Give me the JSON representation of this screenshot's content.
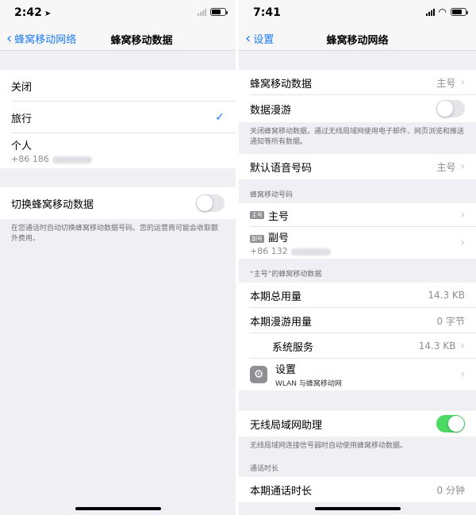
{
  "left": {
    "status": {
      "time": "2:42",
      "location_glyph": "➤"
    },
    "nav": {
      "back_label": "蜂窝移动网络",
      "title": "蜂窝移动数据"
    },
    "lines": [
      {
        "label": "关闭"
      },
      {
        "label": "旅行",
        "checked": true
      },
      {
        "label": "个人",
        "number": "+86 186"
      }
    ],
    "switch_row": {
      "label": "切换蜂窝移动数据",
      "on": false
    },
    "footer": "在您通话时自动切换蜂窝移动数据号码。您的运营商可能会收取额外费用。"
  },
  "right": {
    "status": {
      "time": "7:41"
    },
    "nav": {
      "back_label": "设置",
      "title": "蜂窝移动网络"
    },
    "group1": {
      "cellular_data_label": "蜂窝移动数据",
      "cellular_data_value": "主号",
      "roaming_label": "数据漫游",
      "roaming_on": false
    },
    "footer1": "关闭蜂窝移动数据，通过无线局域网使用电子邮件、网页浏览和推送通知等所有数据。",
    "default_voice": {
      "label": "默认语音号码",
      "value": "主号"
    },
    "numbers_header": "蜂窝移动号码",
    "numbers": [
      {
        "badge": "主号",
        "label": "主号"
      },
      {
        "badge": "副号",
        "label": "副号",
        "number": "+86 132"
      }
    ],
    "usage_header": "“主号”的蜂窝移动数据",
    "usage": [
      {
        "label": "本期总用量",
        "value": "14.3 KB"
      },
      {
        "label": "本期漫游用量",
        "value": "0 字节"
      },
      {
        "label": "系统服务",
        "value": "14.3 KB"
      }
    ],
    "settings_app": {
      "label": "设置",
      "sub": "WLAN 与蜂窝移动网"
    },
    "wifi_assist": {
      "label": "无线局域网助理",
      "on": true
    },
    "footer2": "无线局域网连接信号弱时自动使用蜂窝移动数据。",
    "call_header": "通话时长",
    "call_row": {
      "label": "本期通话时长",
      "value": "0 分钟"
    }
  },
  "colors": {
    "accent": "#1a7cf5",
    "toggle_on": "#4cd964",
    "background": "#efeff4"
  }
}
